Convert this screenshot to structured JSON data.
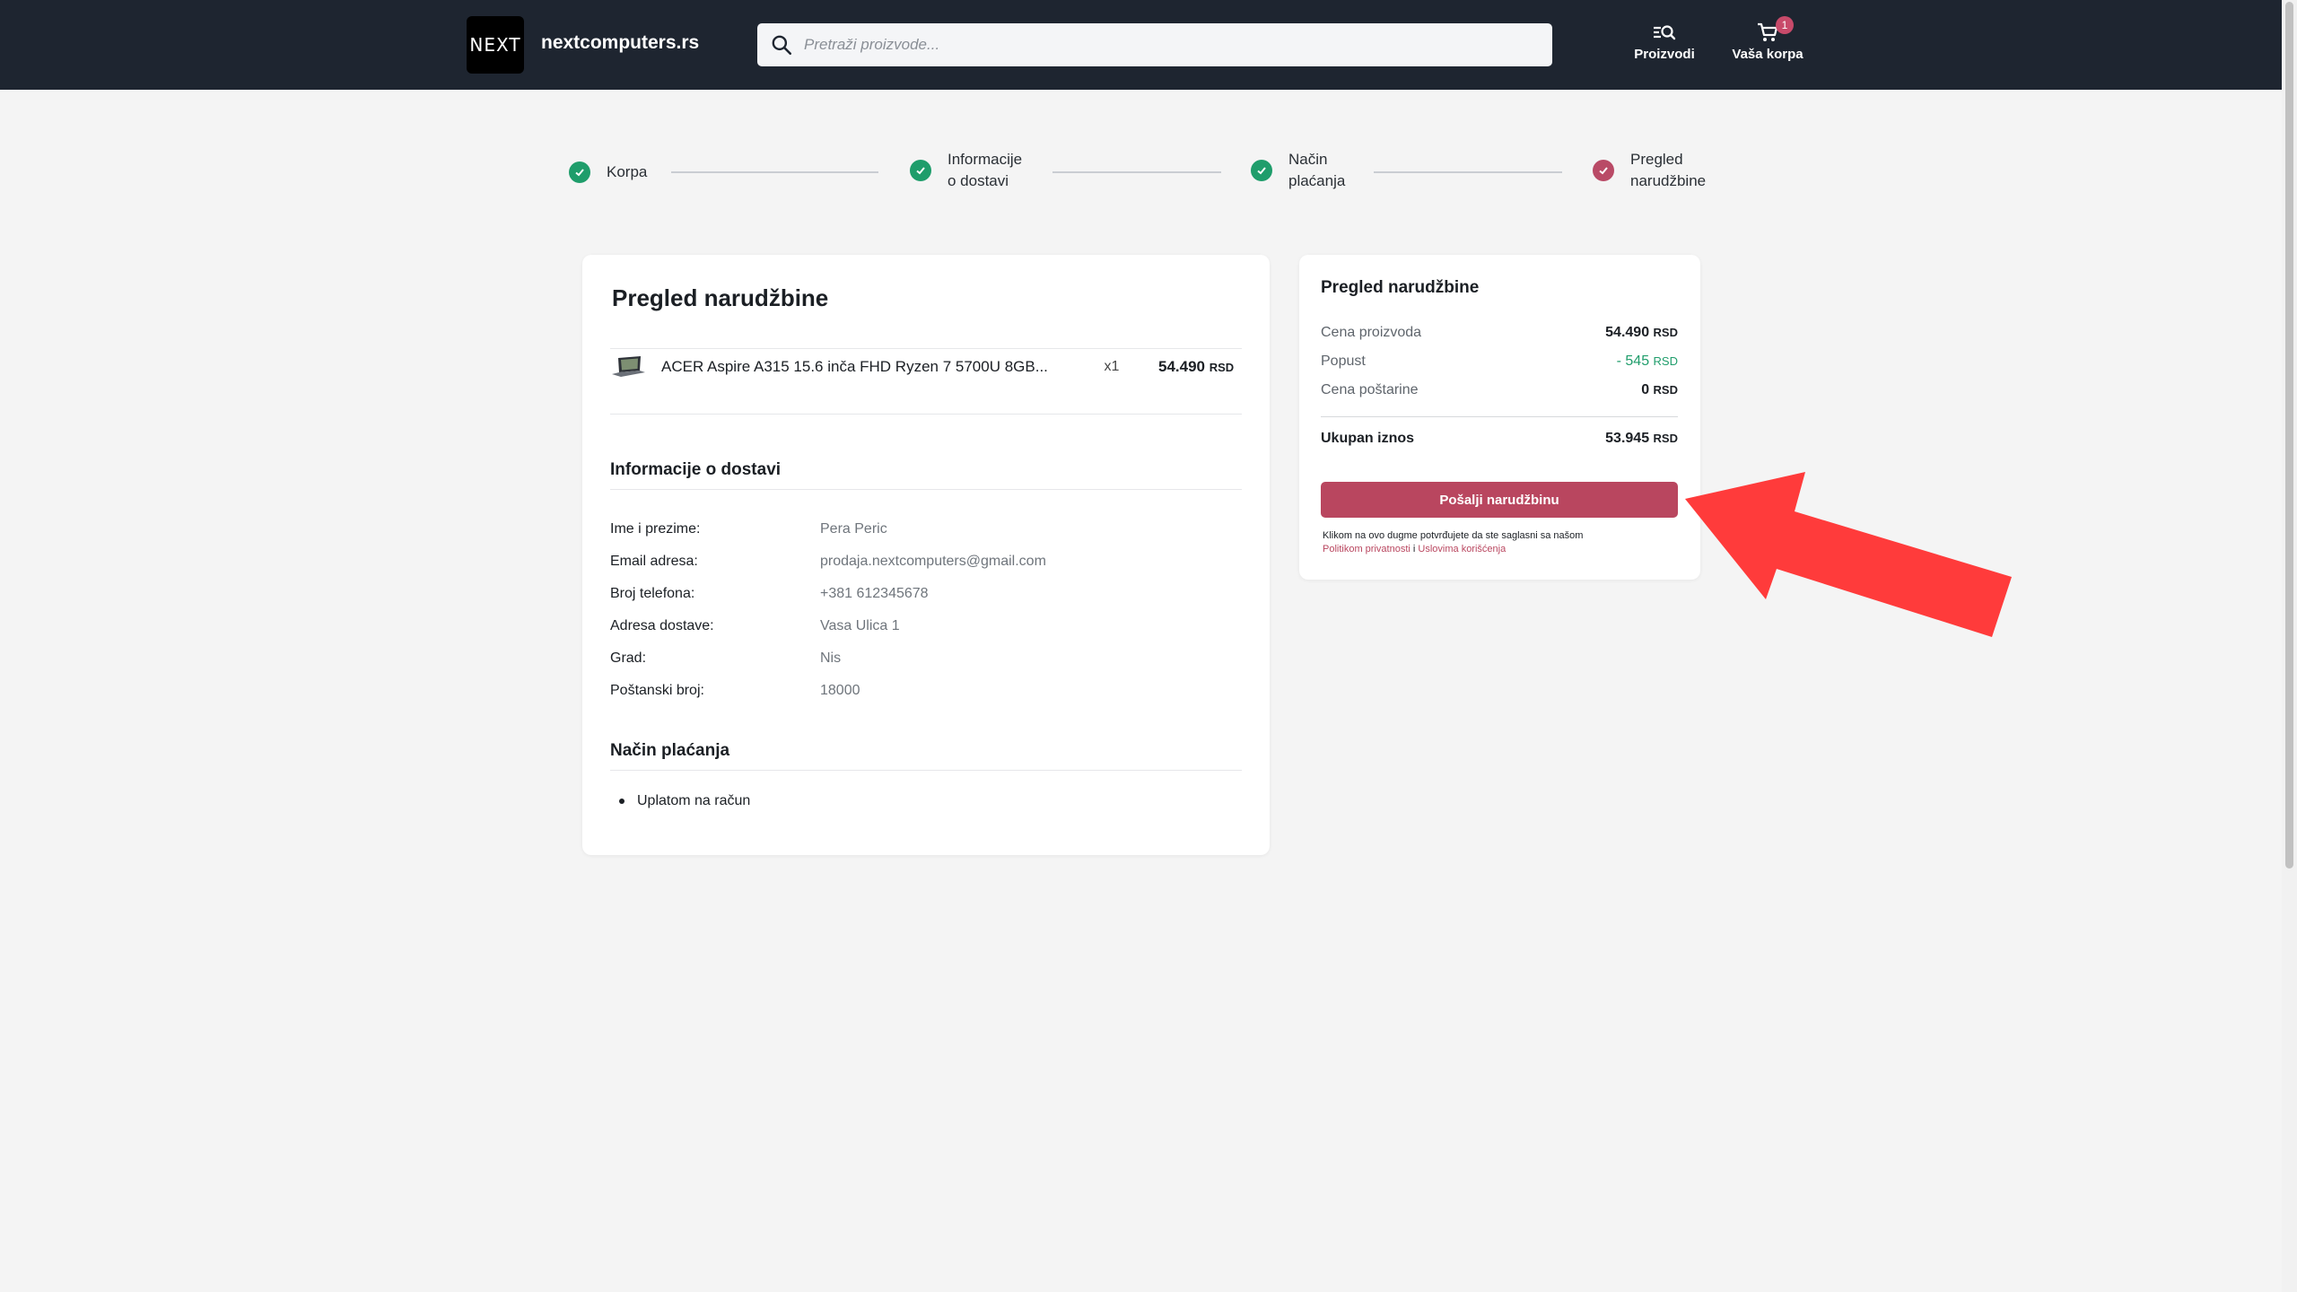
{
  "header": {
    "logo_text": "NEXT",
    "site_name": "nextcomputers.rs",
    "search_placeholder": "Pretraži proizvode...",
    "products_label": "Proizvodi",
    "cart_label": "Vaša korpa",
    "cart_count": "1"
  },
  "stepper": {
    "steps": [
      {
        "label_1": "Korpa",
        "label_2": "",
        "state": "done"
      },
      {
        "label_1": "Informacije",
        "label_2": "o dostavi",
        "state": "done"
      },
      {
        "label_1": "Način",
        "label_2": "plaćanja",
        "state": "done"
      },
      {
        "label_1": "Pregled",
        "label_2": "narudžbine",
        "state": "active"
      }
    ]
  },
  "order": {
    "title": "Pregled narudžbine",
    "product": {
      "name": "ACER Aspire A315 15.6 inča FHD Ryzen 7 5700U 8GB...",
      "qty": "x1",
      "price": "54.490",
      "currency": "RSD"
    },
    "delivery_title": "Informacije o dostavi",
    "delivery": [
      {
        "label": "Ime i prezime:",
        "value": "Pera Peric"
      },
      {
        "label": "Email adresa:",
        "value": "prodaja.nextcomputers@gmail.com"
      },
      {
        "label": "Broj telefona:",
        "value": "+381 612345678"
      },
      {
        "label": "Adresa dostave:",
        "value": "Vasa Ulica 1"
      },
      {
        "label": "Grad:",
        "value": "Nis"
      },
      {
        "label": "Poštanski broj:",
        "value": "18000"
      }
    ],
    "payment_title": "Način plaćanja",
    "payment_method": "Uplatom na račun"
  },
  "summary": {
    "title": "Pregled narudžbine",
    "product_price_label": "Cena proizvoda",
    "product_price": "54.490",
    "discount_label": "Popust",
    "discount": "- 545",
    "shipping_label": "Cena poštarine",
    "shipping": "0",
    "total_label": "Ukupan iznos",
    "total": "53.945",
    "currency": "RSD",
    "submit_label": "Pošalji narudžbinu",
    "terms_text": "Klikom na ovo dugme potvrđujete da ste saglasni sa našom",
    "privacy_link": "Politikom privatnosti",
    "and": "i",
    "terms_link": "Uslovima korišćenja"
  },
  "colors": {
    "header_bg": "#1e2530",
    "accent": "#b9465f",
    "success": "#1f9d6b",
    "annotation_arrow": "#ff3b3b"
  }
}
